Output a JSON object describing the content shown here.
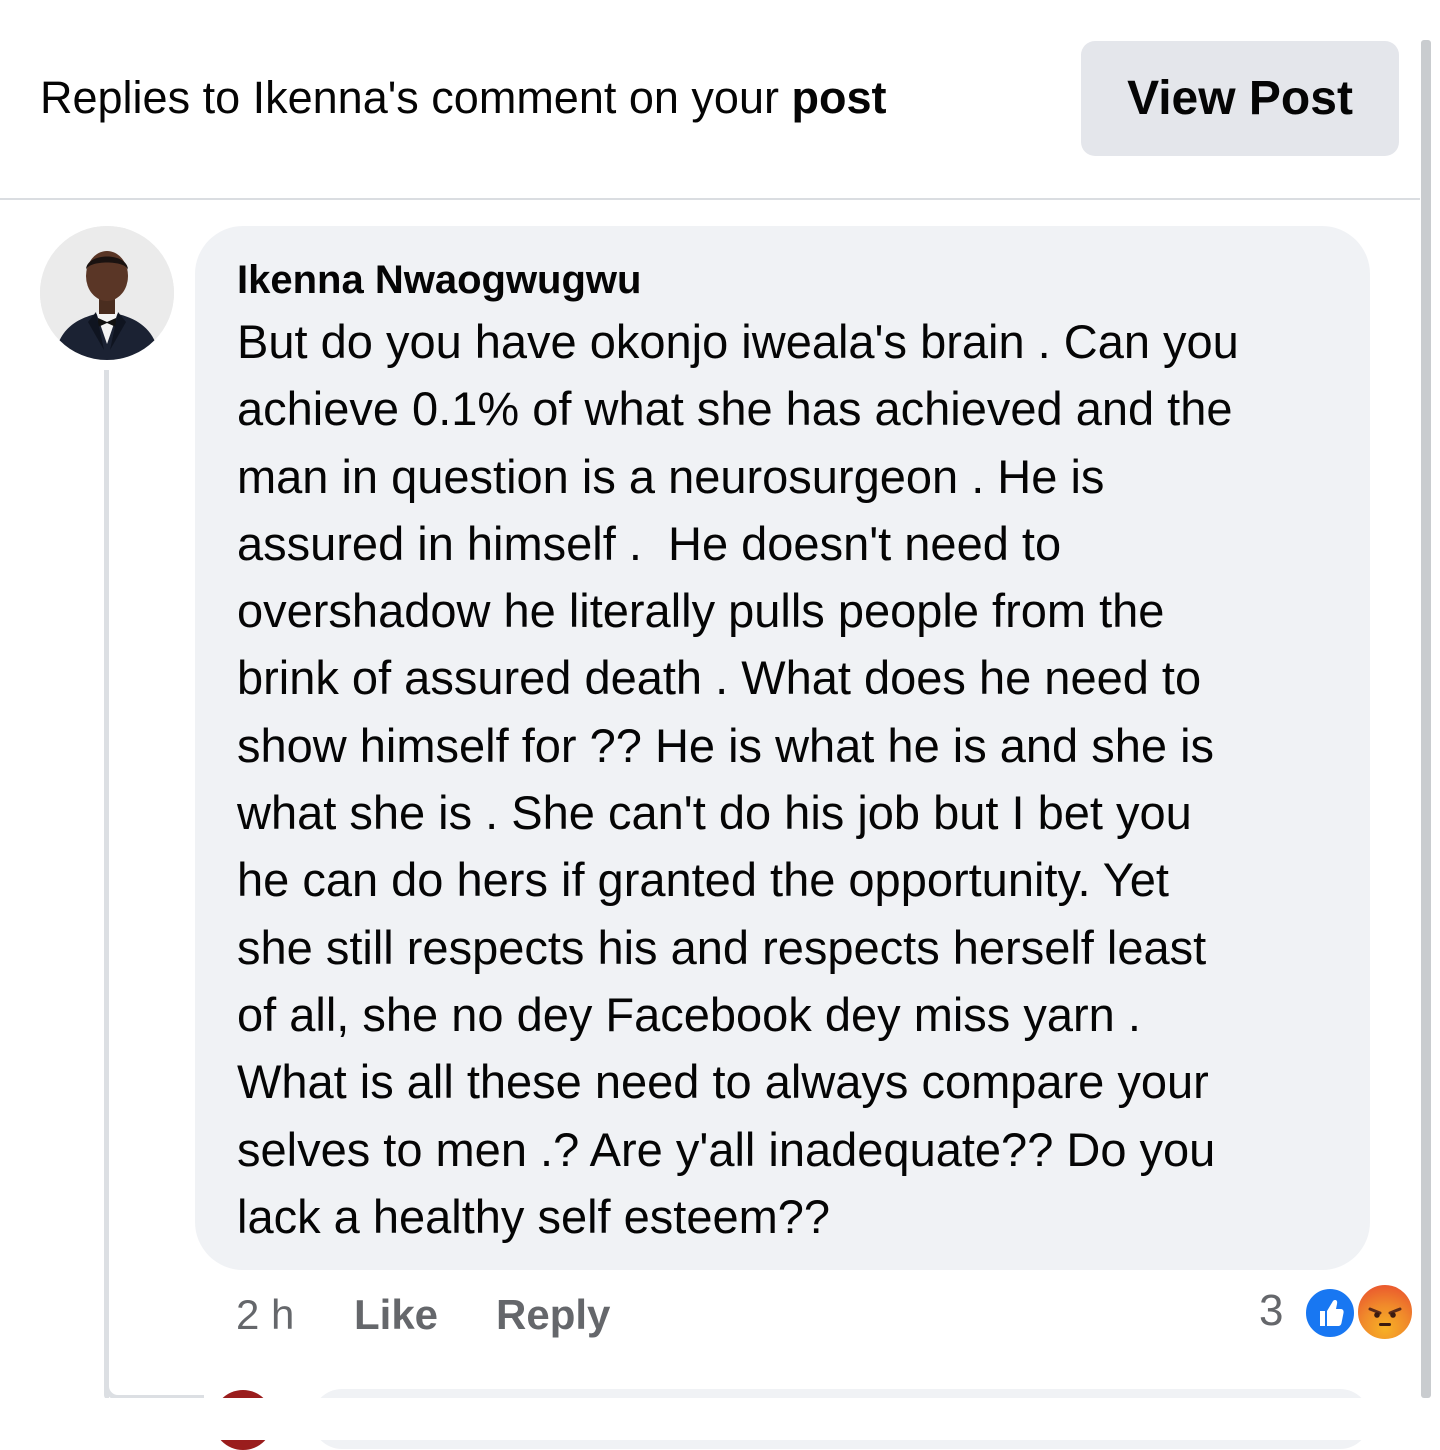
{
  "header": {
    "title_prefix": "Replies to Ikenna's comment on your ",
    "title_bold": "post",
    "view_post_label": "View Post"
  },
  "comment": {
    "author": "Ikenna Nwaogwugwu",
    "lines": [
      "But do you have okonjo iweala's brain . Can you",
      "achieve 0.1% of what she has achieved and the",
      "man in question is a neurosurgeon . He is",
      "assured in himself .  He doesn't need to",
      "overshadow he literally pulls people from the",
      "brink of assured death . What does he need to",
      "show himself for ?? He is what he is and she is",
      "what she is . She can't do his job but I bet you",
      "he can do hers if granted the opportunity. Yet",
      "she still respects his and respects herself least",
      "of all, she no dey Facebook dey miss yarn .",
      "What is all these need to always compare your",
      "selves to men .? Are y'all inadequate?? Do you",
      "lack a healthy self esteem??"
    ],
    "time": "2 h",
    "like_label": "Like",
    "reply_label": "Reply",
    "reaction_count": "3",
    "reactions": [
      "like-icon",
      "angry-icon"
    ]
  },
  "colors": {
    "bubble_bg": "#f0f2f5",
    "button_bg": "#e4e6eb",
    "meta_text": "#65676b",
    "like_blue": "#1877f2"
  }
}
